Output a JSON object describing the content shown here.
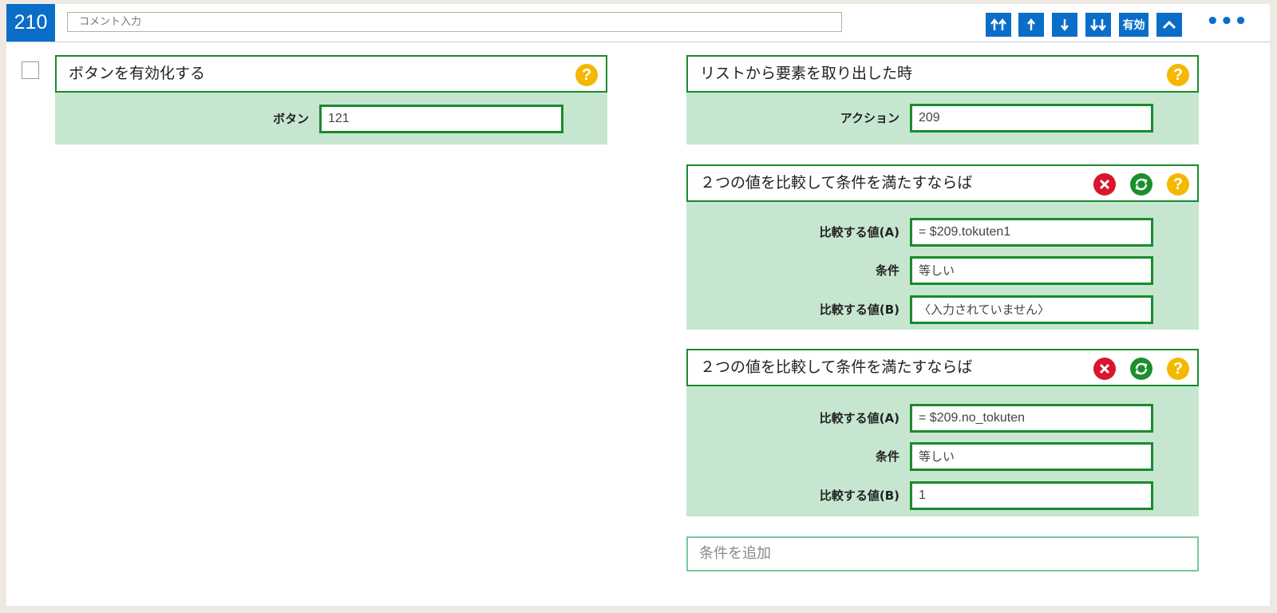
{
  "header": {
    "id": "210",
    "comment_placeholder": "コメント入力",
    "buttons": {
      "move_top": "⇈",
      "move_up": "↑",
      "move_down": "↓",
      "move_bottom": "⇊",
      "enable": "有効",
      "collapse": "︿"
    },
    "more": "•••"
  },
  "left_block": {
    "title": "ボタンを有効化する",
    "help": "?",
    "field_label": "ボタン",
    "field_value": "121"
  },
  "right_blocks": {
    "event": {
      "title": "リストから要素を取り出した時",
      "help": "?",
      "field_label": "アクション",
      "field_value": "209"
    },
    "compare1": {
      "title": "２つの値を比較して条件を満たすならば",
      "help": "?",
      "fields": [
        {
          "label": "比較する値(A)",
          "value": "= $209.tokuten1"
        },
        {
          "label": "条件",
          "value": "等しい"
        },
        {
          "label": "比較する値(B)",
          "value": "〈入力されていません〉"
        }
      ]
    },
    "compare2": {
      "title": "２つの値を比較して条件を満たすならば",
      "help": "?",
      "fields": [
        {
          "label": "比較する値(A)",
          "value": "= $209.no_tokuten"
        },
        {
          "label": "条件",
          "value": "等しい"
        },
        {
          "label": "比較する値(B)",
          "value": "1"
        }
      ]
    }
  },
  "add_condition": "条件を追加",
  "colors": {
    "accent_blue": "#0a6ec8",
    "block_green": "#1a8a2e",
    "block_bg": "#c6e6d0",
    "help_yellow": "#f5b800",
    "delete_red": "#d9162d"
  }
}
